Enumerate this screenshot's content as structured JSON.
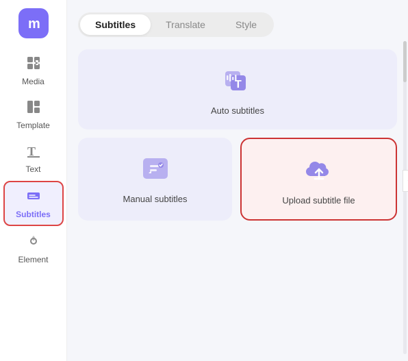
{
  "app": {
    "logo_letter": "m"
  },
  "sidebar": {
    "items": [
      {
        "id": "media",
        "label": "Media",
        "icon": "media"
      },
      {
        "id": "template",
        "label": "Template",
        "icon": "template"
      },
      {
        "id": "text",
        "label": "Text",
        "icon": "text"
      },
      {
        "id": "subtitles",
        "label": "Subtitles",
        "icon": "subtitles",
        "active": true
      },
      {
        "id": "element",
        "label": "Element",
        "icon": "element"
      }
    ]
  },
  "main": {
    "tabs": [
      {
        "id": "subtitles",
        "label": "Subtitles",
        "active": true
      },
      {
        "id": "translate",
        "label": "Translate",
        "active": false
      },
      {
        "id": "style",
        "label": "Style",
        "active": false
      }
    ],
    "cards": {
      "auto_subtitles": {
        "label": "Auto subtitles"
      },
      "manual_subtitles": {
        "label": "Manual subtitles"
      },
      "upload_subtitle_file": {
        "label": "Upload subtitle file",
        "selected": true
      }
    }
  }
}
